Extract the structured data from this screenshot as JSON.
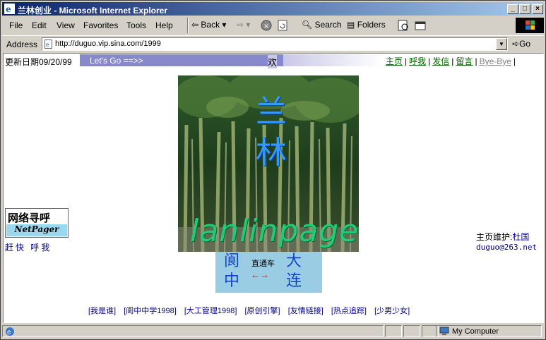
{
  "window": {
    "title": "兰林创业 - Microsoft Internet Explorer",
    "controls": {
      "minimize": "_",
      "maximize": "□",
      "close": "×"
    }
  },
  "menu": {
    "items": [
      "File",
      "Edit",
      "View",
      "Favorites",
      "Tools",
      "Help"
    ]
  },
  "toolbar": {
    "back": "Back",
    "search": "Search",
    "folders": "Folders"
  },
  "address": {
    "label": "Address",
    "url": "http://duguo.vip.sina.com/1999",
    "go": "Go"
  },
  "page": {
    "update_text": "更新日期09/20/99",
    "marquee_text": "Let's Go ==>>",
    "marquee_welcome": "欢",
    "top_links": [
      "主页",
      "呼我",
      "发信",
      "留言",
      "Bye-Bye"
    ],
    "banner_title": [
      "兰",
      "林"
    ],
    "banner_subtitle": "lanlinpage",
    "netpager_zh": "网络寻呼",
    "netpager_en": "NetPager",
    "hurry_text": "赶快 呼我",
    "maintainer_label": "主页维护:",
    "maintainer_name": "杜国",
    "email": "duguo@263.net",
    "train": {
      "left": [
        "阆",
        "中"
      ],
      "right": [
        "大",
        "连"
      ],
      "middle": "直通车",
      "arrow": "←→"
    },
    "nav_links": [
      "[我是谁]",
      "[阆中中学1998]",
      "[大工管理1998]",
      "[原创引擎]",
      "[友情链接]",
      "[热点追踪]",
      "[少男少女]"
    ]
  },
  "status": {
    "zone": "My Computer"
  }
}
